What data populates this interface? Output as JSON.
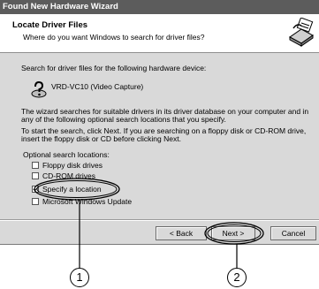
{
  "window": {
    "title": "Found New Hardware Wizard"
  },
  "header": {
    "title": "Locate Driver Files",
    "subtitle": "Where do you want Windows to search for driver files?",
    "graphic_icon": "hardware-driver-icon"
  },
  "body": {
    "intro": "Search for driver files for the following hardware device:",
    "device_icon": "unknown-device-icon",
    "device_name": "VRD-VC10 (Video Capture)",
    "paragraph1_line1": "The wizard searches for suitable drivers in its driver database on your computer and in",
    "paragraph1_line2": "any of the following optional search locations that you specify.",
    "paragraph2_line1": "To start the search, click Next. If you are searching on a floppy disk or CD-ROM drive,",
    "paragraph2_line2": "insert the floppy disk or CD before clicking Next.",
    "options_label": "Optional search locations:",
    "options": [
      {
        "label": "Floppy disk drives",
        "checked": false
      },
      {
        "label": "CD-ROM drives",
        "checked": false
      },
      {
        "label": "Specify a location",
        "checked": true
      },
      {
        "label": "Microsoft Windows Update",
        "checked": false
      }
    ]
  },
  "buttons": {
    "back": "< Back",
    "next": "Next >",
    "cancel": "Cancel"
  },
  "callouts": {
    "one": "1",
    "two": "2"
  }
}
